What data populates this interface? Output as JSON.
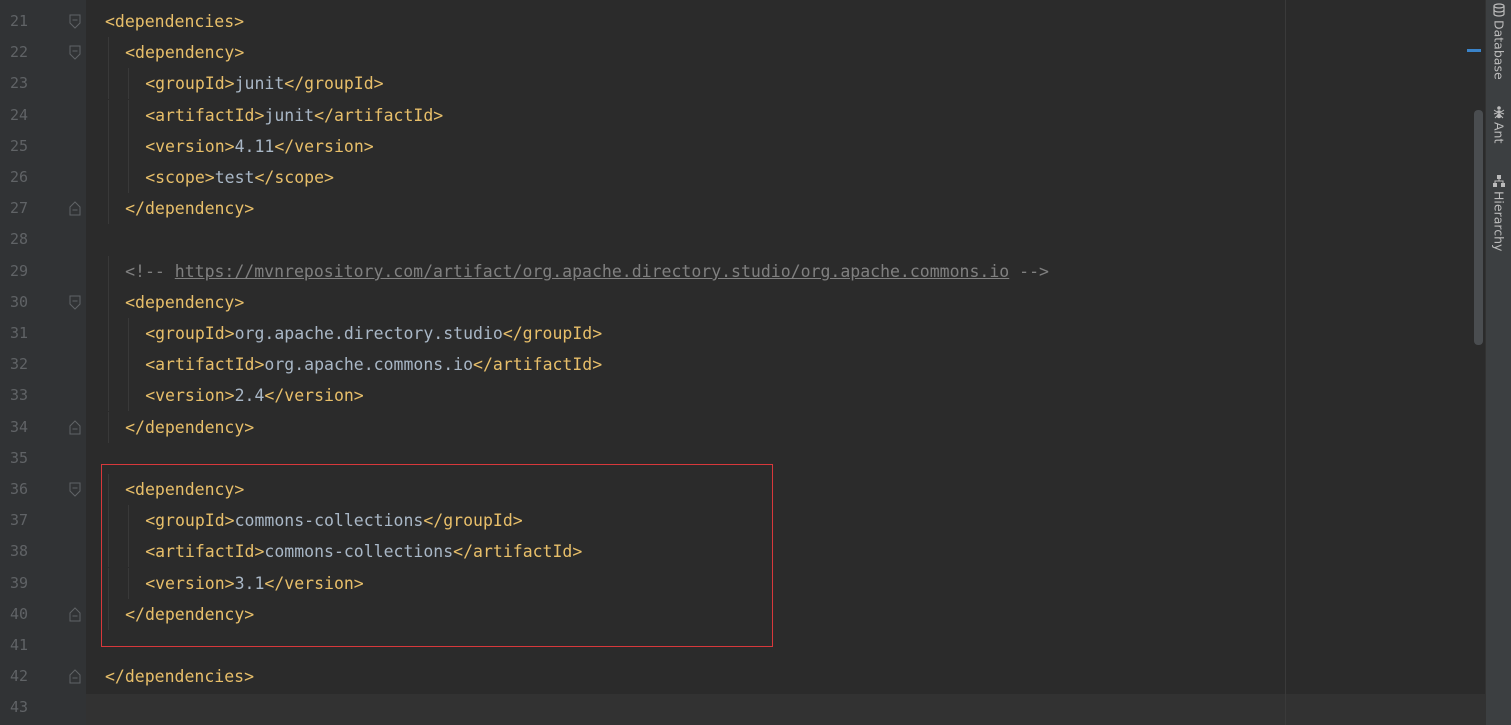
{
  "editor": {
    "lines": [
      {
        "num": "21",
        "fold": "open",
        "indent": 0,
        "parts": [
          {
            "t": "tag",
            "v": "<dependencies>"
          }
        ]
      },
      {
        "num": "22",
        "fold": "open",
        "indent": 1,
        "parts": [
          {
            "t": "tag",
            "v": "<dependency>"
          }
        ]
      },
      {
        "num": "23",
        "fold": "",
        "indent": 2,
        "parts": [
          {
            "t": "tag",
            "v": "<groupId>"
          },
          {
            "t": "txt",
            "v": "junit"
          },
          {
            "t": "tag",
            "v": "</groupId>"
          }
        ]
      },
      {
        "num": "24",
        "fold": "",
        "indent": 2,
        "parts": [
          {
            "t": "tag",
            "v": "<artifactId>"
          },
          {
            "t": "txt",
            "v": "junit"
          },
          {
            "t": "tag",
            "v": "</artifactId>"
          }
        ]
      },
      {
        "num": "25",
        "fold": "",
        "indent": 2,
        "parts": [
          {
            "t": "tag",
            "v": "<version>"
          },
          {
            "t": "txt",
            "v": "4.11"
          },
          {
            "t": "tag",
            "v": "</version>"
          }
        ]
      },
      {
        "num": "26",
        "fold": "",
        "indent": 2,
        "parts": [
          {
            "t": "tag",
            "v": "<scope>"
          },
          {
            "t": "txt",
            "v": "test"
          },
          {
            "t": "tag",
            "v": "</scope>"
          }
        ]
      },
      {
        "num": "27",
        "fold": "close",
        "indent": 1,
        "parts": [
          {
            "t": "tag",
            "v": "</dependency>"
          }
        ]
      },
      {
        "num": "28",
        "fold": "",
        "indent": 0,
        "parts": []
      },
      {
        "num": "29",
        "fold": "",
        "indent": 1,
        "parts": [
          {
            "t": "cmt",
            "v": "<!-- "
          },
          {
            "t": "link",
            "v": "https://mvnrepository.com/artifact/org.apache.directory.studio/org.apache.commons.io"
          },
          {
            "t": "cmt",
            "v": " -->"
          }
        ]
      },
      {
        "num": "30",
        "fold": "open",
        "indent": 1,
        "parts": [
          {
            "t": "tag",
            "v": "<dependency>"
          }
        ]
      },
      {
        "num": "31",
        "fold": "",
        "indent": 2,
        "parts": [
          {
            "t": "tag",
            "v": "<groupId>"
          },
          {
            "t": "txt",
            "v": "org.apache.directory.studio"
          },
          {
            "t": "tag",
            "v": "</groupId>"
          }
        ]
      },
      {
        "num": "32",
        "fold": "",
        "indent": 2,
        "parts": [
          {
            "t": "tag",
            "v": "<artifactId>"
          },
          {
            "t": "txt",
            "v": "org.apache.commons.io"
          },
          {
            "t": "tag",
            "v": "</artifactId>"
          }
        ]
      },
      {
        "num": "33",
        "fold": "",
        "indent": 2,
        "parts": [
          {
            "t": "tag",
            "v": "<version>"
          },
          {
            "t": "txt",
            "v": "2.4"
          },
          {
            "t": "tag",
            "v": "</version>"
          }
        ]
      },
      {
        "num": "34",
        "fold": "close",
        "indent": 1,
        "parts": [
          {
            "t": "tag",
            "v": "</dependency>"
          }
        ]
      },
      {
        "num": "35",
        "fold": "",
        "indent": 0,
        "parts": []
      },
      {
        "num": "36",
        "fold": "open",
        "indent": 1,
        "parts": [
          {
            "t": "tag",
            "v": "<dependency>"
          }
        ]
      },
      {
        "num": "37",
        "fold": "",
        "indent": 2,
        "parts": [
          {
            "t": "tag",
            "v": "<groupId>"
          },
          {
            "t": "txt",
            "v": "commons-collections"
          },
          {
            "t": "tag",
            "v": "</groupId>"
          }
        ]
      },
      {
        "num": "38",
        "fold": "",
        "indent": 2,
        "parts": [
          {
            "t": "tag",
            "v": "<artifactId>"
          },
          {
            "t": "txt",
            "v": "commons-collections"
          },
          {
            "t": "tag",
            "v": "</artifactId>"
          }
        ]
      },
      {
        "num": "39",
        "fold": "",
        "indent": 2,
        "parts": [
          {
            "t": "tag",
            "v": "<version>"
          },
          {
            "t": "txt",
            "v": "3.1"
          },
          {
            "t": "tag",
            "v": "</version>"
          }
        ]
      },
      {
        "num": "40",
        "fold": "close",
        "indent": 1,
        "parts": [
          {
            "t": "tag",
            "v": "</dependency>"
          }
        ]
      },
      {
        "num": "41",
        "fold": "",
        "indent": 0,
        "parts": []
      },
      {
        "num": "42",
        "fold": "close",
        "indent": 0,
        "parts": [
          {
            "t": "tag",
            "v": "</dependencies>"
          }
        ]
      },
      {
        "num": "43",
        "fold": "",
        "indent": 0,
        "parts": []
      }
    ]
  },
  "side_panel": {
    "tabs": [
      {
        "label": "Database",
        "icon": "database-icon"
      },
      {
        "label": "Ant",
        "icon": "ant-icon"
      },
      {
        "label": "Hierarchy",
        "icon": "hierarchy-icon"
      }
    ]
  },
  "colors": {
    "tag": "#e8bf6a",
    "text": "#a9b7c6",
    "comment": "#808080",
    "highlight_box": "#d8383b"
  }
}
